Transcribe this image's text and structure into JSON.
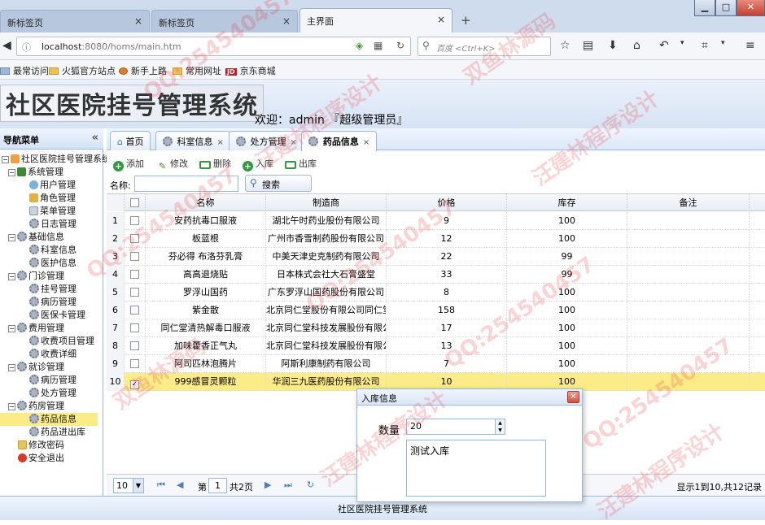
{
  "browser": {
    "tabs": [
      {
        "label": "新标签页"
      },
      {
        "label": "新标签页"
      },
      {
        "label": "主界面"
      }
    ],
    "url_host": "localhost",
    "url_rest": ":8080/homs/main.htm",
    "search_placeholder": "百度 <Ctrl+K>",
    "bookmarks": [
      "最常访问",
      "火狐官方站点",
      "新手上路",
      "常用网址",
      "京东商城"
    ],
    "jd_badge": "JD"
  },
  "app": {
    "title": "社区医院挂号管理系统",
    "welcome": "欢迎：admin 『超级管理员』",
    "footer": "社区医院挂号管理系统"
  },
  "sidebar": {
    "title": "导航菜单",
    "collapse_glyph": "«",
    "root": "社区医院挂号管理系统",
    "groups": [
      {
        "label": "系统管理",
        "items": [
          "用户管理",
          "角色管理",
          "菜单管理",
          "日志管理"
        ]
      },
      {
        "label": "基础信息",
        "items": [
          "科室信息",
          "医护信息"
        ]
      },
      {
        "label": "门诊管理",
        "items": [
          "挂号管理",
          "病历管理",
          "医保卡管理"
        ]
      },
      {
        "label": "费用管理",
        "items": [
          "收费项目管理",
          "收费详细"
        ]
      },
      {
        "label": "就诊管理",
        "items": [
          "病历管理",
          "处方管理"
        ]
      },
      {
        "label": "药房管理",
        "items": [
          "药品信息",
          "药品进出库"
        ]
      }
    ],
    "extra": [
      "修改密码",
      "安全退出"
    ],
    "selected": "药品信息"
  },
  "tabs": [
    {
      "label": "首页",
      "closable": false
    },
    {
      "label": "科室信息",
      "closable": true
    },
    {
      "label": "处方管理",
      "closable": true
    },
    {
      "label": "药品信息",
      "closable": true,
      "active": true
    }
  ],
  "toolbar": {
    "add": "添加",
    "edit": "修改",
    "delete": "删除",
    "in": "入库",
    "out": "出库",
    "name_label": "名称:",
    "search": "搜索"
  },
  "table": {
    "columns": [
      "名称",
      "制造商",
      "价格",
      "库存",
      "备注"
    ],
    "rows": [
      {
        "n": "1",
        "name": "安药抗毒口服液",
        "maker": "湖北午时药业股份有限公司",
        "price": "9",
        "stock": "100",
        "note": "",
        "checked": false
      },
      {
        "n": "2",
        "name": "板蓝根",
        "maker": "广州市香雪制药股份有限公司",
        "price": "12",
        "stock": "100",
        "note": "",
        "checked": false
      },
      {
        "n": "3",
        "name": "芬必得 布洛芬乳膏",
        "maker": "中美天津史克制药有限公司",
        "price": "22",
        "stock": "99",
        "note": "",
        "checked": false
      },
      {
        "n": "4",
        "name": "高高退烧贴",
        "maker": "日本株式会社大石膏盛堂",
        "price": "33",
        "stock": "99",
        "note": "",
        "checked": false
      },
      {
        "n": "5",
        "name": "罗浮山国药",
        "maker": "广东罗浮山国药股份有限公司",
        "price": "8",
        "stock": "100",
        "note": "",
        "checked": false
      },
      {
        "n": "6",
        "name": "紫金散",
        "maker": "北京同仁堂股份有限公司同仁堂",
        "price": "158",
        "stock": "100",
        "note": "",
        "checked": false
      },
      {
        "n": "7",
        "name": "同仁堂清热解毒口服液",
        "maker": "北京同仁堂科技发展股份有限公",
        "price": "17",
        "stock": "100",
        "note": "",
        "checked": false
      },
      {
        "n": "8",
        "name": "加味藿香正气丸",
        "maker": "北京同仁堂科技发展股份有限公",
        "price": "13",
        "stock": "100",
        "note": "",
        "checked": false
      },
      {
        "n": "9",
        "name": "阿司匹林泡腾片",
        "maker": "阿斯利康制药有限公司",
        "price": "7",
        "stock": "100",
        "note": "",
        "checked": false
      },
      {
        "n": "10",
        "name": "999感冒灵颗粒",
        "maker": "华润三九医药股份有限公司",
        "price": "10",
        "stock": "100",
        "note": "",
        "checked": true
      }
    ]
  },
  "pager": {
    "page_size": "10",
    "page_prefix": "第",
    "page": "1",
    "page_total": "共2页",
    "info": "显示1到10,共12记录"
  },
  "dialog": {
    "title": "入库信息",
    "qty_label": "数量",
    "qty": "20",
    "note": "测试入库"
  },
  "watermarks": [
    "QQ:254540457",
    "汪建林程序设计",
    "双鱼林源码"
  ],
  "colors": {
    "accent_border": "#95b8e7",
    "selected_row": "#fbec88"
  }
}
